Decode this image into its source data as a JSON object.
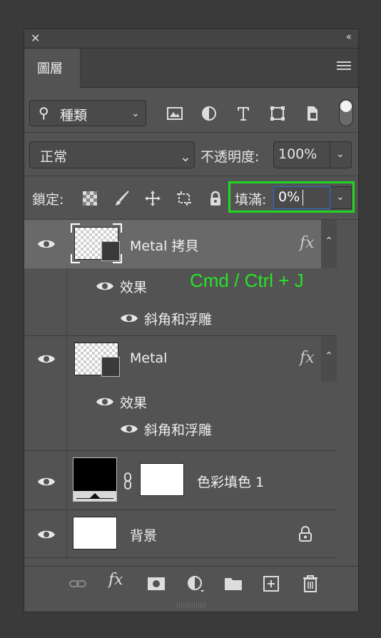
{
  "panel": {
    "tab_label": "圖層"
  },
  "filter": {
    "kind_label": "種類"
  },
  "blend": {
    "mode": "正常",
    "opacity_label": "不透明度:",
    "opacity_value": "100%"
  },
  "lock": {
    "label": "鎖定:",
    "fill_label": "填滿:",
    "fill_value": "0%"
  },
  "layers": [
    {
      "name": "Metal 拷貝",
      "fx": "fx",
      "effects_label": "效果",
      "effect": "斜角和浮雕",
      "selected": true
    },
    {
      "name": "Metal",
      "fx": "fx",
      "effects_label": "效果",
      "effect": "斜角和浮雕"
    },
    {
      "name": "色彩填色 1"
    },
    {
      "name": "背景",
      "locked": true
    }
  ],
  "annotation": "Cmd / Ctrl + J",
  "colors": {
    "highlight": "#1fd81f",
    "annotation": "#27e427",
    "panel_bg": "#535353"
  }
}
